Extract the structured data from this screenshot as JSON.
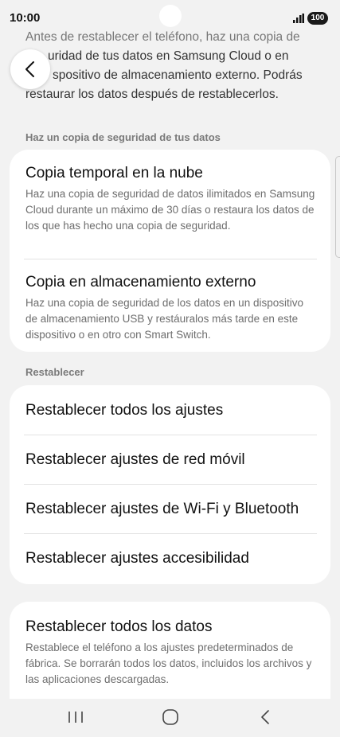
{
  "status": {
    "time": "10:00",
    "battery": "100"
  },
  "intro": {
    "line1": "Antes de restablecer el teléfono, haz una copia de",
    "line2": "uridad de tus datos en Samsung Cloud o en",
    "line3": "spositivo de almacenamiento externo. Podrás",
    "line4": "restaurar los datos después de restablecerlos."
  },
  "backup_section": {
    "header": "Haz un copia de seguridad de tus datos",
    "items": [
      {
        "title": "Copia temporal en la nube",
        "desc": "Haz una copia de seguridad de datos ilimitados en Samsung Cloud durante un máximo de 30 días o restaura los datos de los que has hecho una copia de seguridad."
      },
      {
        "title": "Copia en almacenamiento externo",
        "desc": "Haz una copia de seguridad de los datos en un dispositivo de almacenamiento USB y restáuralos más tarde en este dispositivo o en otro con Smart Switch."
      }
    ]
  },
  "reset_section": {
    "header": "Restablecer",
    "items": [
      "Restablecer todos los ajustes",
      "Restablecer ajustes de red móvil",
      "Restablecer ajustes de Wi-Fi y Bluetooth",
      "Restablecer ajustes accesibilidad"
    ]
  },
  "factory_reset": {
    "title": "Restablecer todos los datos",
    "desc": "Restablece el teléfono a los ajustes predeterminados de fábrica. Se borrarán todos los datos, incluidos los archivos y las aplicaciones descargadas."
  },
  "icons": {
    "back": "chevron-left-icon",
    "signal": "signal-icon",
    "battery": "battery-icon",
    "nav_recents": "recents-icon",
    "nav_home": "home-icon",
    "nav_back": "back-icon"
  }
}
